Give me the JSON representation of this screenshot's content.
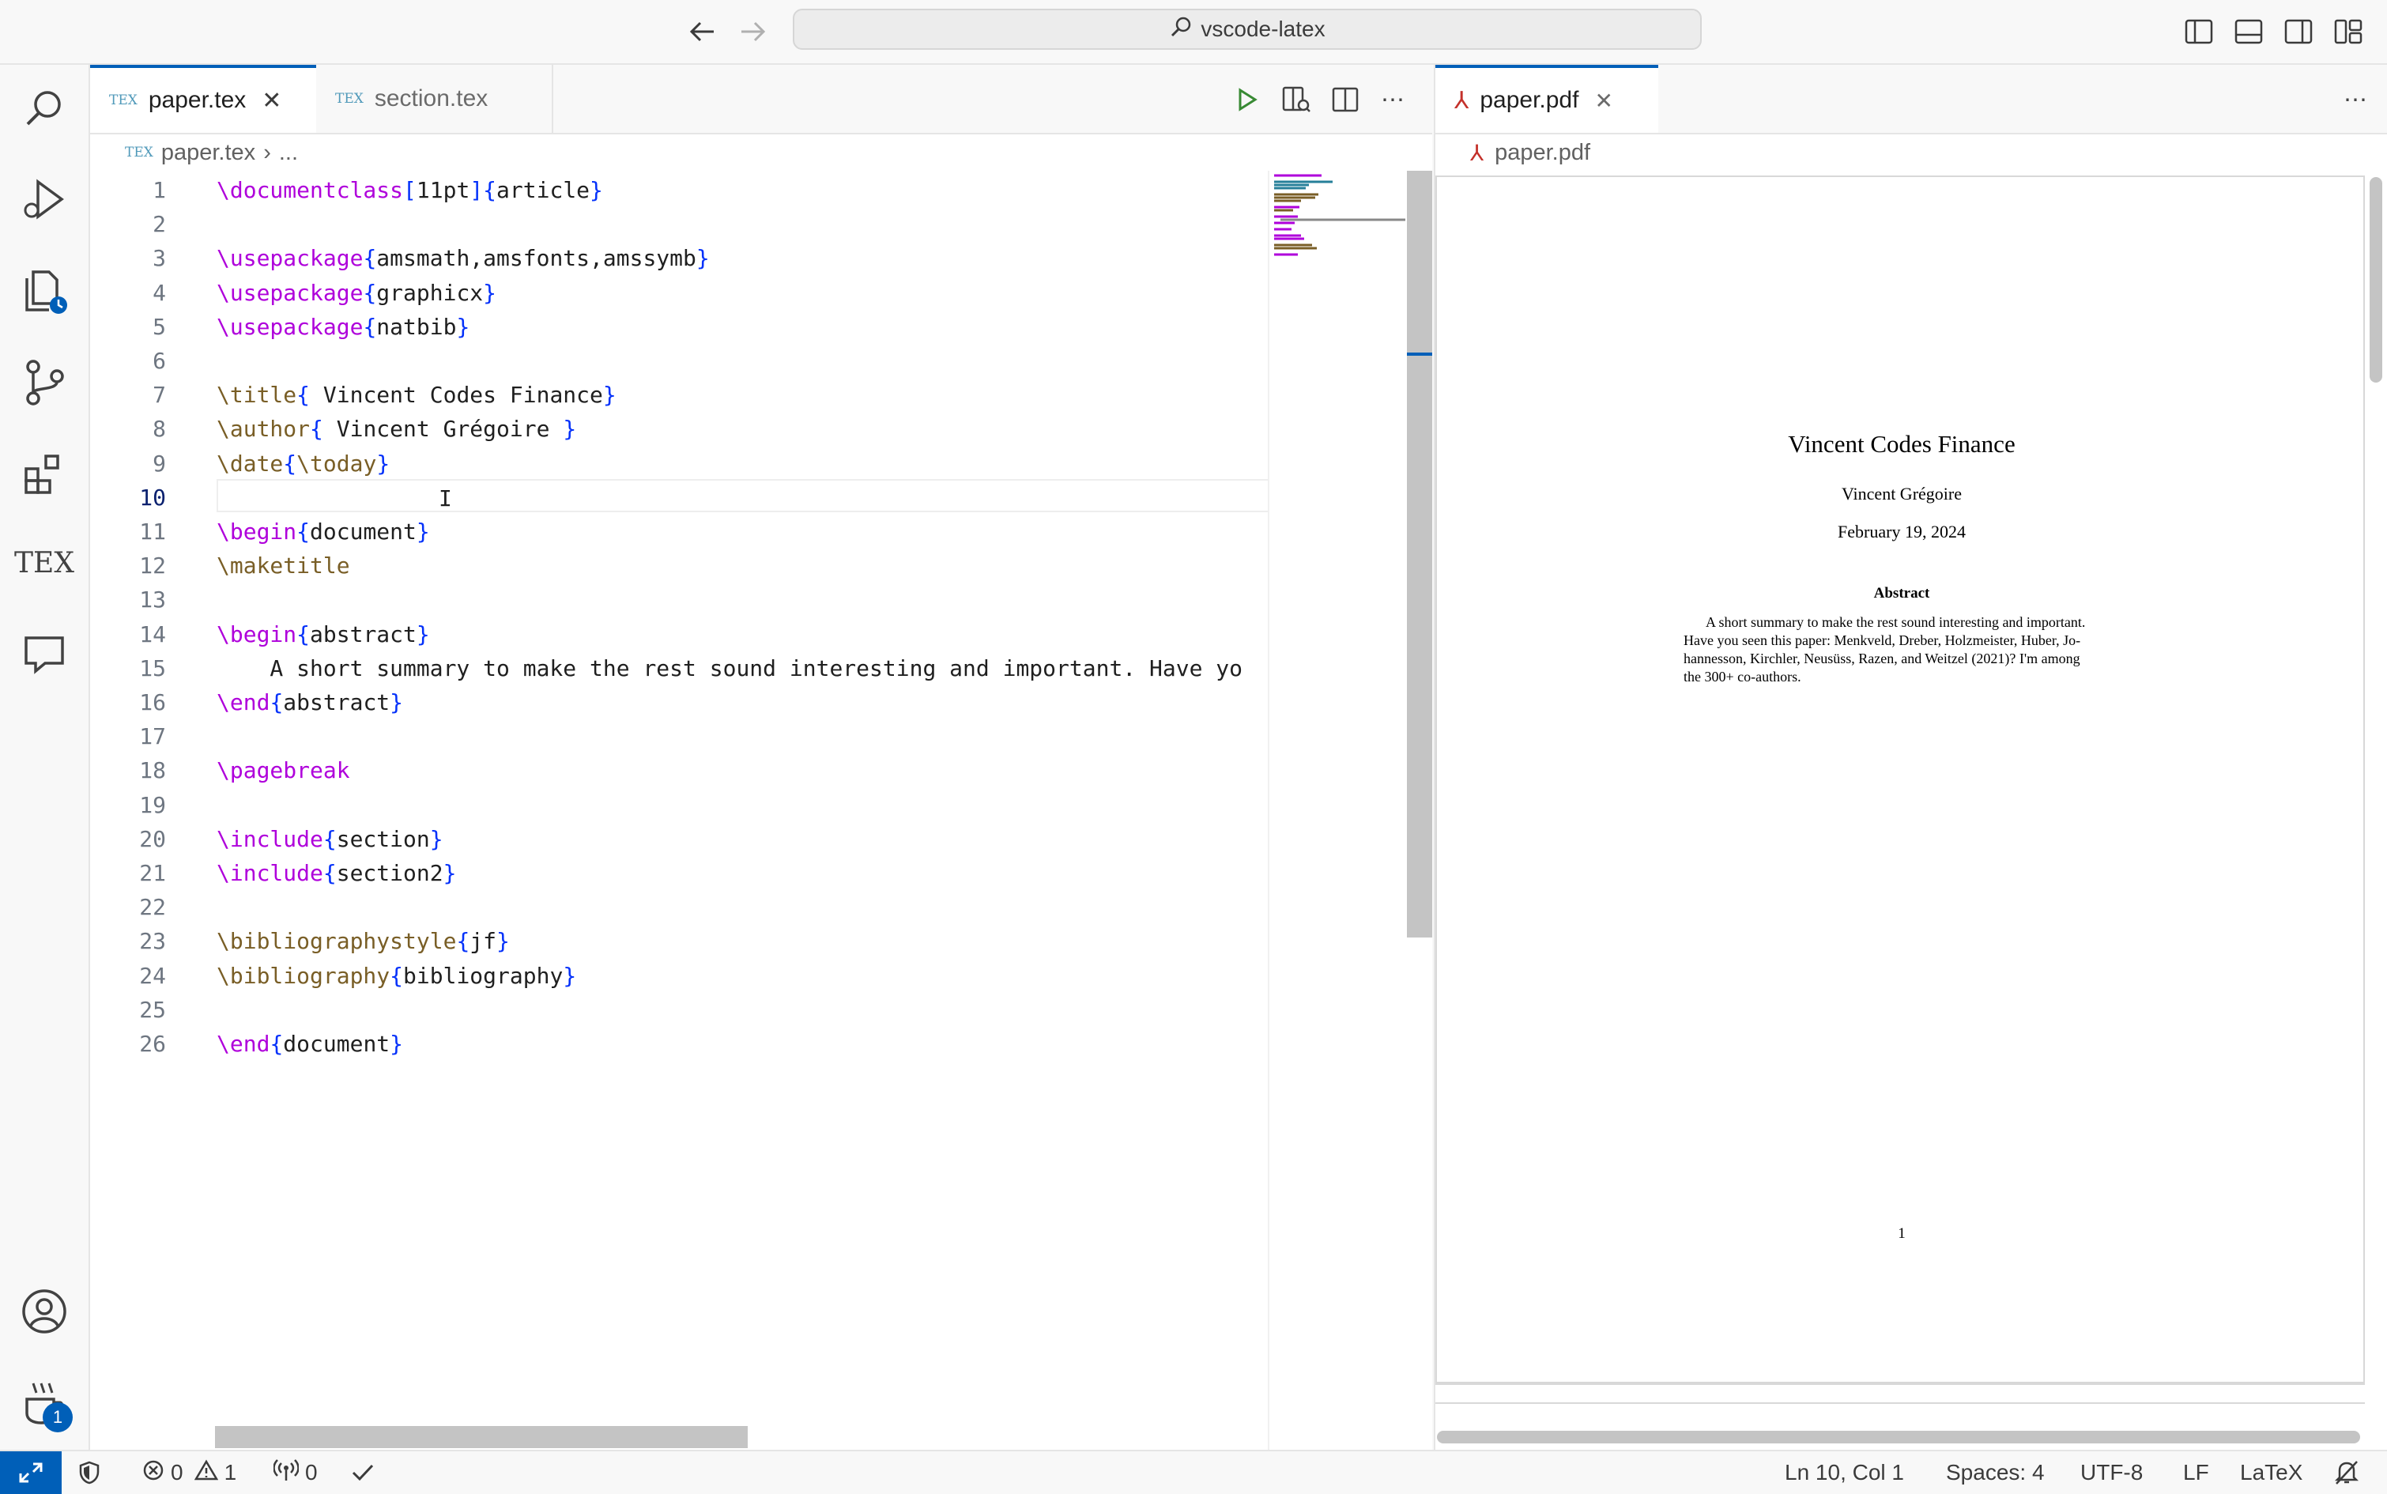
{
  "titlebar": {
    "search_text": "vscode-latex",
    "icons": [
      "back-arrow-icon",
      "forward-arrow-icon",
      "search-icon",
      "toggle-primary-sidebar-icon",
      "toggle-panel-icon",
      "toggle-secondary-sidebar-icon",
      "customize-layout-icon"
    ]
  },
  "activitybar": {
    "items": [
      "search-icon",
      "run-debug-icon",
      "timeline-explorer-icon",
      "source-control-icon",
      "extensions-icon",
      "tex-icon",
      "comments-icon",
      "accounts-icon",
      "coffee-icon"
    ],
    "tex_label": "TEX",
    "coffee_badge": "1"
  },
  "editor": {
    "tabs": [
      {
        "label": "paper.tex",
        "active": true
      },
      {
        "label": "section.tex",
        "active": false
      }
    ],
    "breadcrumb": {
      "file": "paper.tex",
      "sep": "›",
      "rest": "..."
    },
    "current_line": 10,
    "lines": [
      {
        "n": "1",
        "code": "\\documentclass[11pt]{article}"
      },
      {
        "n": "2",
        "code": ""
      },
      {
        "n": "3",
        "code": "\\usepackage{amsmath,amsfonts,amssymb}"
      },
      {
        "n": "4",
        "code": "\\usepackage{graphicx}"
      },
      {
        "n": "5",
        "code": "\\usepackage{natbib}"
      },
      {
        "n": "6",
        "code": ""
      },
      {
        "n": "7",
        "code": "\\title{ Vincent Codes Finance}"
      },
      {
        "n": "8",
        "code": "\\author{ Vincent Grégoire }"
      },
      {
        "n": "9",
        "code": "\\date{\\today}"
      },
      {
        "n": "10",
        "code": ""
      },
      {
        "n": "11",
        "code": "\\begin{document}"
      },
      {
        "n": "12",
        "code": "\\maketitle"
      },
      {
        "n": "13",
        "code": ""
      },
      {
        "n": "14",
        "code": "\\begin{abstract}"
      },
      {
        "n": "15",
        "code": "    A short summary to make the rest sound interesting and important. Have yo"
      },
      {
        "n": "16",
        "code": "\\end{abstract}"
      },
      {
        "n": "17",
        "code": ""
      },
      {
        "n": "18",
        "code": "\\pagebreak"
      },
      {
        "n": "19",
        "code": ""
      },
      {
        "n": "20",
        "code": "\\include{section}"
      },
      {
        "n": "21",
        "code": "\\include{section2}"
      },
      {
        "n": "22",
        "code": ""
      },
      {
        "n": "23",
        "code": "\\bibliographystyle{jf}"
      },
      {
        "n": "24",
        "code": "\\bibliography{bibliography}"
      },
      {
        "n": "25",
        "code": ""
      },
      {
        "n": "26",
        "code": "\\end{document}"
      }
    ]
  },
  "pdf": {
    "tab_label": "paper.pdf",
    "breadcrumb": "paper.pdf",
    "title": "Vincent Codes Finance",
    "author": "Vincent Grégoire",
    "date": "February 19, 2024",
    "abstract_heading": "Abstract",
    "abstract_lines": [
      "A short summary to make the rest sound interesting and important.",
      "Have you seen this paper: Menkveld, Dreber, Holzmeister, Huber, Jo-",
      "hannesson, Kirchler, Neusüss, Razen, and Weitzel (2021)? I'm among",
      "the 300+ co-authors."
    ],
    "page_number": "1"
  },
  "statusbar": {
    "errors": "0",
    "warnings": "1",
    "ports": "0",
    "position": "Ln 10, Col 1",
    "spaces": "Spaces: 4",
    "encoding": "UTF-8",
    "eol": "LF",
    "language": "LaTeX"
  },
  "colors": {
    "accent": "#005fb8",
    "keyword": "#795e26",
    "command": "#af00db",
    "brace": "#0431fa"
  }
}
